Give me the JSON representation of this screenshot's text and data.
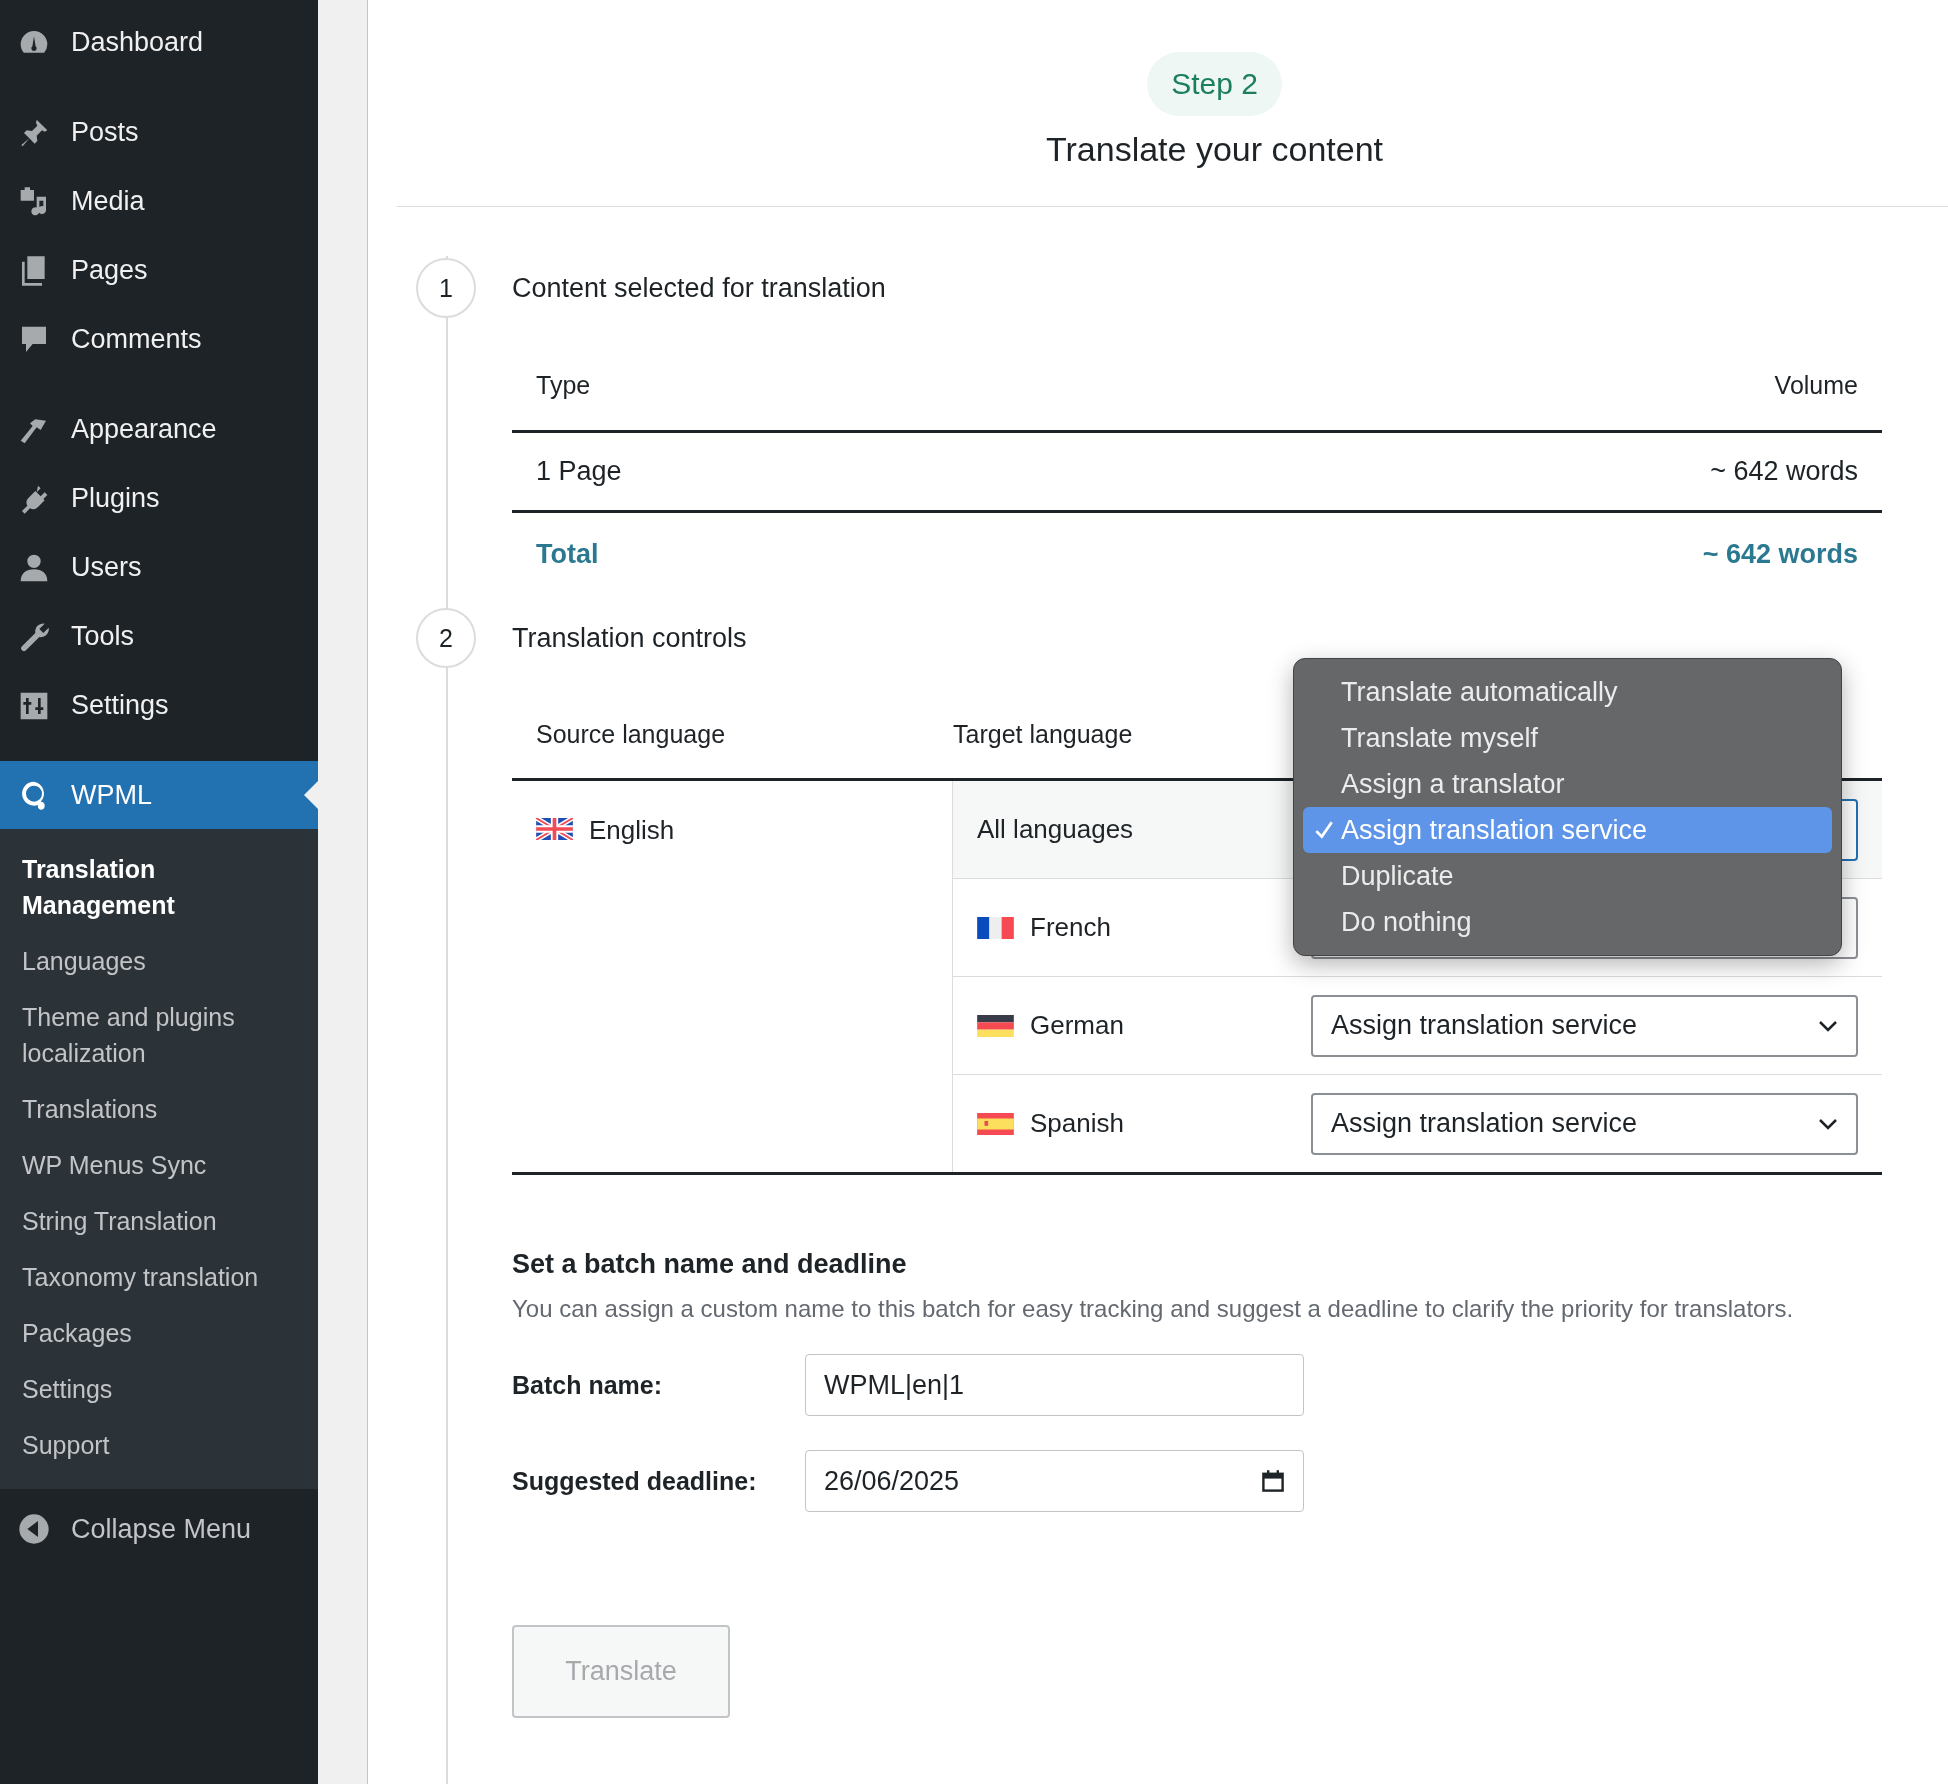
{
  "sidebar": {
    "groups": [
      [
        {
          "label": "Dashboard",
          "selected": false
        }
      ],
      [
        {
          "label": "Posts",
          "selected": false
        },
        {
          "label": "Media",
          "selected": false
        },
        {
          "label": "Pages",
          "selected": false
        },
        {
          "label": "Comments",
          "selected": false
        }
      ],
      [
        {
          "label": "Appearance",
          "selected": false
        },
        {
          "label": "Plugins",
          "selected": false
        },
        {
          "label": "Users",
          "selected": false
        },
        {
          "label": "Tools",
          "selected": false
        },
        {
          "label": "Settings",
          "selected": false
        }
      ],
      [
        {
          "label": "WPML",
          "selected": true
        }
      ]
    ],
    "submenu": [
      {
        "label": "Translation Management",
        "selected": true
      },
      {
        "label": "Languages",
        "selected": false
      },
      {
        "label": "Theme and plugins localization",
        "selected": false
      },
      {
        "label": "Translations",
        "selected": false
      },
      {
        "label": "WP Menus Sync",
        "selected": false
      },
      {
        "label": "String Translation",
        "selected": false
      },
      {
        "label": "Taxonomy translation",
        "selected": false
      },
      {
        "label": "Packages",
        "selected": false
      },
      {
        "label": "Settings",
        "selected": false
      },
      {
        "label": "Support",
        "selected": false
      }
    ],
    "collapse": "Collapse Menu"
  },
  "header": {
    "step": "Step 2",
    "title": "Translate your content"
  },
  "content_section": {
    "number": "1",
    "title": "Content selected for translation",
    "columns": [
      "Type",
      "Volume"
    ],
    "rows": [
      {
        "type": "1 Page",
        "volume": "~ 642 words"
      }
    ],
    "total": {
      "label": "Total",
      "value": "~ 642 words"
    }
  },
  "controls_section": {
    "number": "2",
    "title": "Translation controls",
    "columns": [
      "Source language",
      "Target language"
    ],
    "source": "English",
    "targets": [
      {
        "kind": "all",
        "language": "All languages",
        "focused": true
      },
      {
        "kind": "language",
        "language": "French",
        "focused": false
      },
      {
        "kind": "language",
        "language": "German",
        "focused": false,
        "action": "Assign translation service"
      },
      {
        "kind": "language",
        "language": "Spanish",
        "focused": false,
        "action": "Assign translation service"
      }
    ]
  },
  "dropdown": {
    "options": [
      {
        "label": "Translate automatically",
        "selected": false
      },
      {
        "label": "Translate myself",
        "selected": false
      },
      {
        "label": "Assign a translator",
        "selected": false
      },
      {
        "label": "Assign translation service",
        "selected": true
      },
      {
        "label": "Duplicate",
        "selected": false
      },
      {
        "label": "Do nothing",
        "selected": false
      }
    ]
  },
  "batch": {
    "title": "Set a batch name and deadline",
    "description": "You can assign a custom name to this batch for easy tracking and suggest a deadline to clarify the priority for translators.",
    "fields": [
      {
        "kind": "text",
        "label": "Batch name:",
        "value": "WPML|en|1"
      },
      {
        "kind": "date",
        "label": "Suggested deadline:",
        "value": "26/06/2025"
      }
    ]
  },
  "translate_button": {
    "label": "Translate",
    "disabled": true
  }
}
